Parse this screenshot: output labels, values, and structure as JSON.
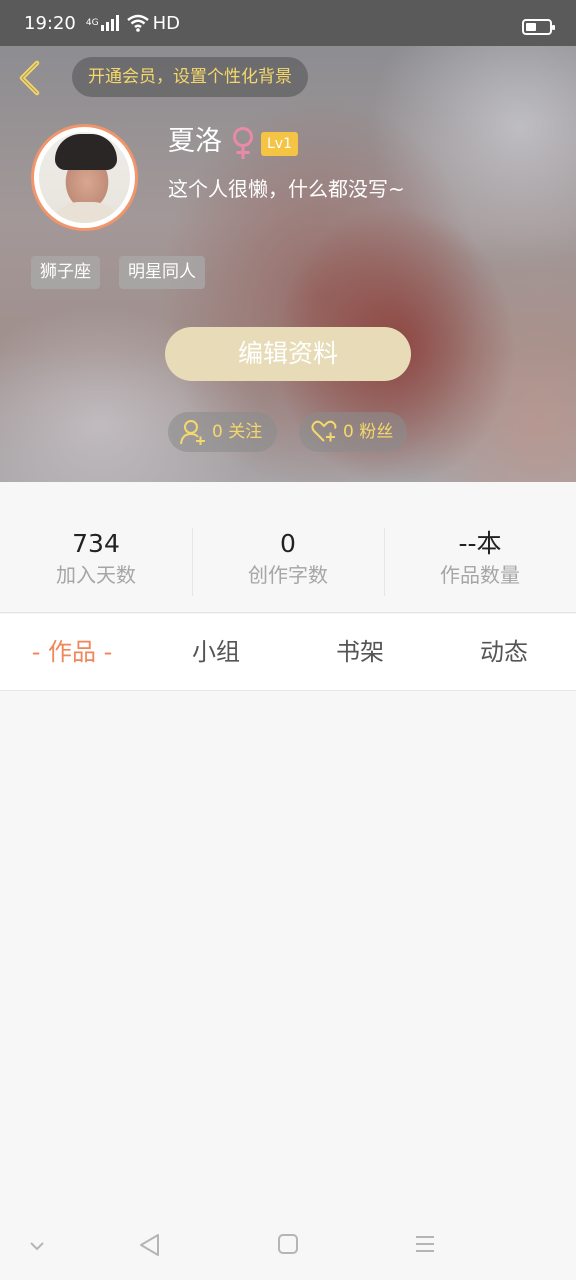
{
  "status_bar": {
    "time": "19:20",
    "network": "4G",
    "hd": "HD",
    "icons": [
      "signal-icon",
      "wifi-icon",
      "battery-icon"
    ]
  },
  "header": {
    "vip_banner": "开通会员，设置个性化背景",
    "nickname": "夏洛",
    "gender_symbol": "♀",
    "level": "Lv1",
    "signature": "这个人很懒，什么都没写~",
    "tags": [
      "狮子座",
      "明星同人"
    ],
    "edit_button": "编辑资料",
    "follow_label": "0 关注",
    "fans_label": "0 粉丝"
  },
  "stats": [
    {
      "value": "734",
      "label": "加入天数"
    },
    {
      "value": "0",
      "label": "创作字数"
    },
    {
      "value": "--本",
      "label": "作品数量"
    }
  ],
  "tabs": [
    {
      "label": "- 作品 -",
      "active": true
    },
    {
      "label": "小组",
      "active": false
    },
    {
      "label": "书架",
      "active": false
    },
    {
      "label": "动态",
      "active": false
    }
  ],
  "colors": {
    "accent": "#f0865a",
    "gold": "#f5d86b",
    "level_badge": "#f6c445",
    "edit_button": "#e7dbb8",
    "gender": "#e88aa8"
  },
  "nav_icons": [
    "collapse-icon",
    "back-triangle-icon",
    "home-square-icon",
    "menu-icon"
  ]
}
